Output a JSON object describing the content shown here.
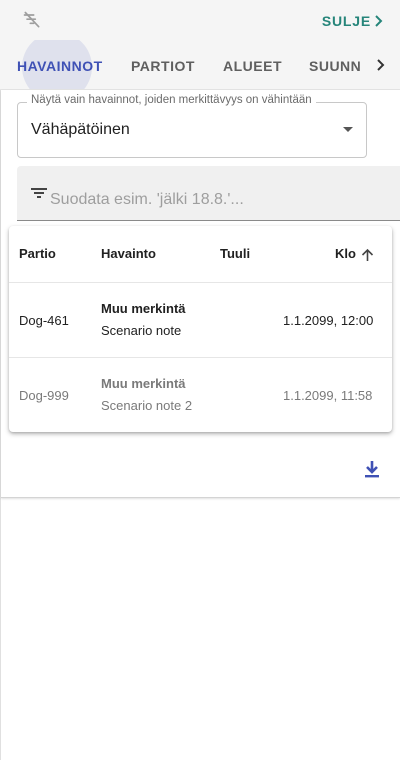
{
  "header": {
    "close_label": "SULJE"
  },
  "tabs": [
    "HAVAINNOT",
    "PARTIOT",
    "ALUEET",
    "SUUNNI"
  ],
  "filter": {
    "legend": "Näytä vain havainnot, joiden merkittävyys on vähintään",
    "selected": "Vähäpätöinen"
  },
  "search": {
    "placeholder": "Suodata esim. 'jälki 18.8.'..."
  },
  "table": {
    "columns": [
      "Partio",
      "Havainto",
      "Tuuli",
      "Klo"
    ],
    "rows": [
      {
        "partio": "Dog-461",
        "title": "Muu merkintä",
        "note": "Scenario note",
        "tuuli": "",
        "klo": "1.1.2099, 12:00"
      },
      {
        "partio": "Dog-999",
        "title": "Muu merkintä",
        "note": "Scenario note 2",
        "tuuli": "",
        "klo": "1.1.2099, 11:58"
      }
    ]
  },
  "colors": {
    "accent": "#3f51b5",
    "close": "#26857a"
  }
}
